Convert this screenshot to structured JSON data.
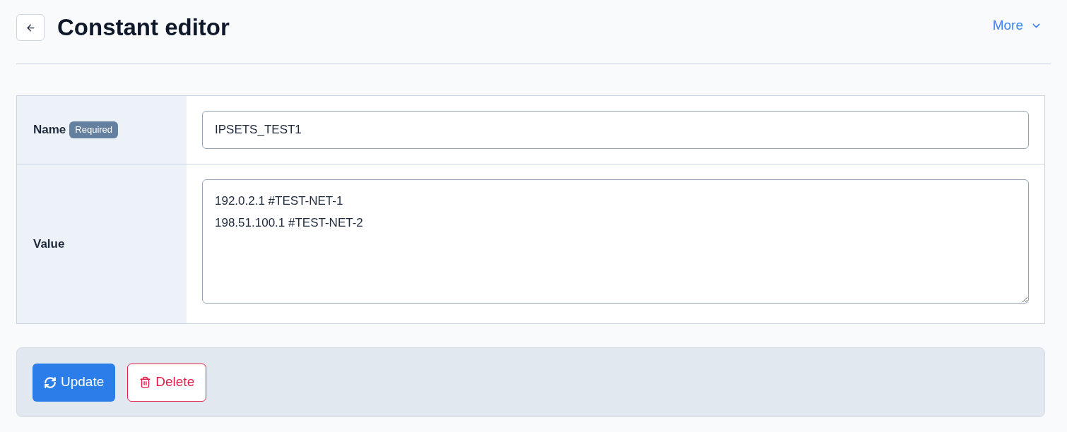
{
  "header": {
    "title": "Constant editor",
    "more_menu": "More"
  },
  "form": {
    "rows": [
      {
        "kind": "input",
        "label": "Name",
        "badge": "Required",
        "value": "IPSETS_TEST1"
      },
      {
        "kind": "textarea",
        "label": "Value",
        "value": "192.0.2.1 #TEST-NET-1\n198.51.100.1 #TEST-NET-2"
      }
    ]
  },
  "actions": [
    {
      "kind": "primary",
      "label": "Update"
    },
    {
      "kind": "danger",
      "label": "Delete"
    }
  ]
}
